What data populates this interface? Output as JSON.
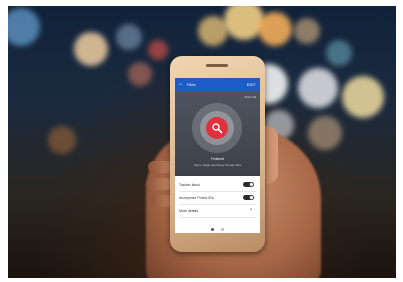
{
  "scene": {
    "description_colors": {
      "app_bar": "#1e5dc7",
      "primary_circle": "#e0313d",
      "hero_bg": "#4e5560"
    }
  },
  "app": {
    "header": {
      "title": "Files",
      "action": "EDIT"
    },
    "hero": {
      "subtitle": "Scan full",
      "caption": "Finished",
      "subcaption": "Tap to begin searching through files"
    },
    "settings": [
      {
        "label": "Tracker block",
        "control": "toggle",
        "on": true
      },
      {
        "label": "Anonymize Phone IDs",
        "control": "toggle",
        "on": true
      },
      {
        "label": "More details",
        "control": "chevron"
      }
    ],
    "pagination": {
      "pages": 2,
      "active": 1
    }
  }
}
